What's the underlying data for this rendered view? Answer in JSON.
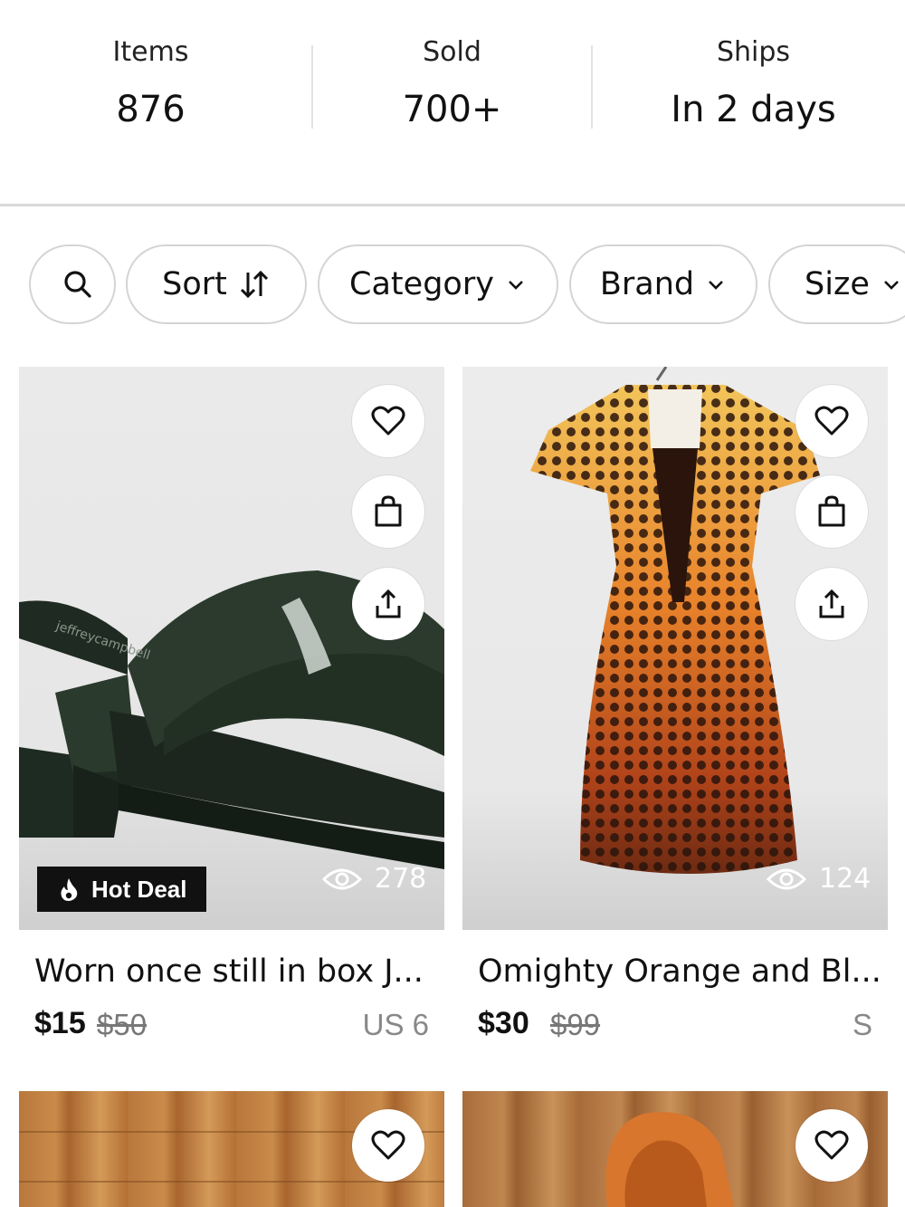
{
  "stats": [
    {
      "label": "Items",
      "value": "876"
    },
    {
      "label": "Sold",
      "value": "700+"
    },
    {
      "label": "Ships",
      "value": "In 2 days"
    }
  ],
  "filters": {
    "search_icon": "search-icon",
    "sort": "Sort",
    "category": "Category",
    "brand": "Brand",
    "size": "Size"
  },
  "products": [
    {
      "title": "Worn once still in box J...",
      "price": "$15",
      "original_price": "$50",
      "size": "US 6",
      "views": "278",
      "badge": "Hot Deal"
    },
    {
      "title": "Omighty Orange and Bl...",
      "price": "$30",
      "original_price": "$99",
      "size": "S",
      "views": "124"
    }
  ],
  "colors": {
    "badge_bg": "#111111",
    "text": "#111111",
    "muted": "#888888",
    "border": "#d4d4d4"
  }
}
